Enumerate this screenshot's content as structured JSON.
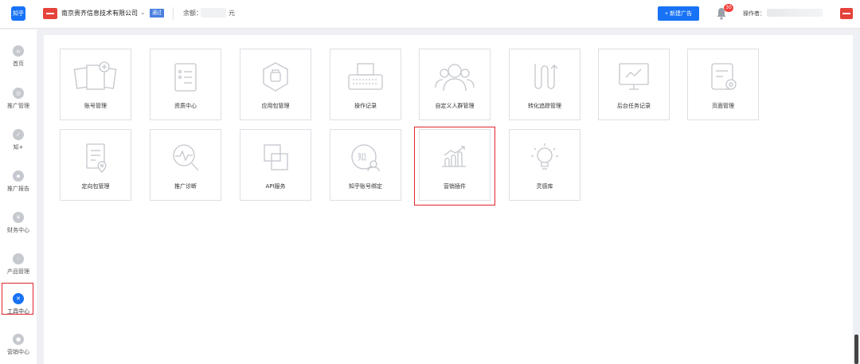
{
  "header": {
    "logo_text": "知乎",
    "company_name": "南京贵齐信息技术有限公司",
    "status_badge": "通过",
    "balance_label": "余额：",
    "balance_unit": "元",
    "new_ad_button": "+ 新建广告",
    "notification_count": "30",
    "operator_label": "操作者："
  },
  "sidebar": {
    "items": [
      {
        "label": "首页",
        "icon": "home-icon"
      },
      {
        "label": "推广管理",
        "icon": "promotion-icon"
      },
      {
        "label": "知+",
        "icon": "zhiplus-icon"
      },
      {
        "label": "推广报告",
        "icon": "report-icon"
      },
      {
        "label": "财务中心",
        "icon": "finance-icon",
        "glyph": "¥"
      },
      {
        "label": "产品管理",
        "icon": "product-icon"
      },
      {
        "label": "工具中心",
        "icon": "tools-icon",
        "active": true
      },
      {
        "label": "营销中心",
        "icon": "marketing-icon"
      }
    ]
  },
  "tools": {
    "row1": [
      {
        "label": "账号管理",
        "icon": "account-cards-icon"
      },
      {
        "label": "资质中心",
        "icon": "qualification-icon"
      },
      {
        "label": "应用包管理",
        "icon": "app-package-icon"
      },
      {
        "label": "操作记录",
        "icon": "typewriter-icon"
      },
      {
        "label": "自定义人群管理",
        "icon": "audience-icon"
      },
      {
        "label": "转化追踪管理",
        "icon": "conversion-track-icon"
      },
      {
        "label": "后台任务记录",
        "icon": "monitor-task-icon"
      },
      {
        "label": "页面管理",
        "icon": "page-settings-icon"
      }
    ],
    "row2": [
      {
        "label": "定向包管理",
        "icon": "targeting-package-icon"
      },
      {
        "label": "推广诊断",
        "icon": "diagnosis-icon"
      },
      {
        "label": "API服务",
        "icon": "api-service-icon"
      },
      {
        "label": "知乎账号绑定",
        "icon": "zhihu-bind-icon",
        "glyph": "知"
      },
      {
        "label": "营销插件",
        "icon": "marketing-plugin-icon",
        "highlighted": true
      },
      {
        "label": "灵感库",
        "icon": "lightbulb-icon"
      }
    ]
  },
  "colors": {
    "brand_blue": "#1772f6",
    "highlight_red": "#e0262d",
    "icon_gray": "#c5c8ce"
  }
}
